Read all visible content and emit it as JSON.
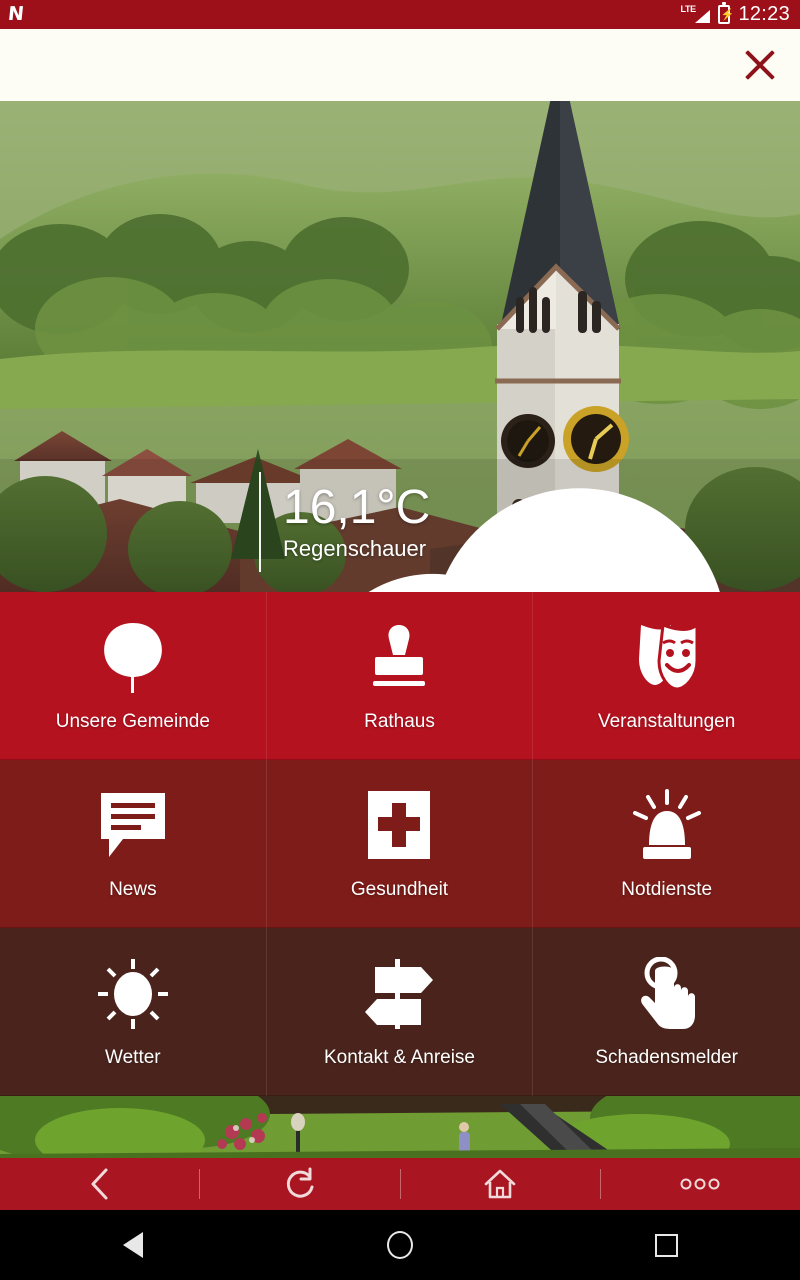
{
  "statusbar": {
    "app_logo": "N",
    "network_label": "LTE",
    "signal_icon": "signal-bars-icon",
    "battery_icon": "battery-charging-icon",
    "time": "12:23"
  },
  "overlay": {
    "close_icon": "close-icon",
    "close_label": "Schließen"
  },
  "hero": {
    "photo_description": "Kirchturm mit Uhr vor grünen Hügeln",
    "weather": {
      "icon": "rain-shower-cloud-icon",
      "temperature": "16,1°C",
      "condition": "Regenschauer"
    }
  },
  "grid": {
    "tiles": [
      {
        "label": "Unsere Gemeinde",
        "icon": "tree-leaf-icon",
        "row": 1,
        "color": "#b5121f"
      },
      {
        "label": "Rathaus",
        "icon": "rubber-stamp-icon",
        "row": 1,
        "color": "#b5121f"
      },
      {
        "label": "Veranstaltungen",
        "icon": "theater-masks-icon",
        "row": 1,
        "color": "#b5121f"
      },
      {
        "label": "News",
        "icon": "speech-bubble-icon",
        "row": 2,
        "color": "#7d1c18"
      },
      {
        "label": "Gesundheit",
        "icon": "medical-cross-icon",
        "row": 2,
        "color": "#7d1c18"
      },
      {
        "label": "Notdienste",
        "icon": "emergency-siren-icon",
        "row": 2,
        "color": "#7d1c18"
      },
      {
        "label": "Wetter",
        "icon": "sun-icon",
        "row": 3,
        "color": "#4a241c"
      },
      {
        "label": "Kontakt & Anreise",
        "icon": "signpost-icon",
        "row": 3,
        "color": "#4a241c"
      },
      {
        "label": "Schadensmelder",
        "icon": "tap-hand-icon",
        "row": 3,
        "color": "#4a241c"
      }
    ]
  },
  "photostrip": {
    "photo_description": "Parkanlage mit Blumen, Rasen und Weg"
  },
  "appnav": {
    "items": [
      {
        "icon": "back-chevron-icon",
        "label": "Zurück"
      },
      {
        "icon": "reload-icon",
        "label": "Neu laden"
      },
      {
        "icon": "home-icon",
        "label": "Startseite"
      },
      {
        "icon": "more-dots-icon",
        "label": "Mehr"
      }
    ]
  },
  "sysnav": {
    "items": [
      {
        "icon": "android-back-icon",
        "label": "Zurück"
      },
      {
        "icon": "android-home-icon",
        "label": "Home"
      },
      {
        "icon": "android-recents-icon",
        "label": "Übersicht"
      }
    ]
  },
  "theme": {
    "brand_red": "#b5121f",
    "statusbar_red": "#9e1019",
    "row2_red": "#7d1c18",
    "row3_red": "#4a241c",
    "navbar_red": "#a91520"
  }
}
